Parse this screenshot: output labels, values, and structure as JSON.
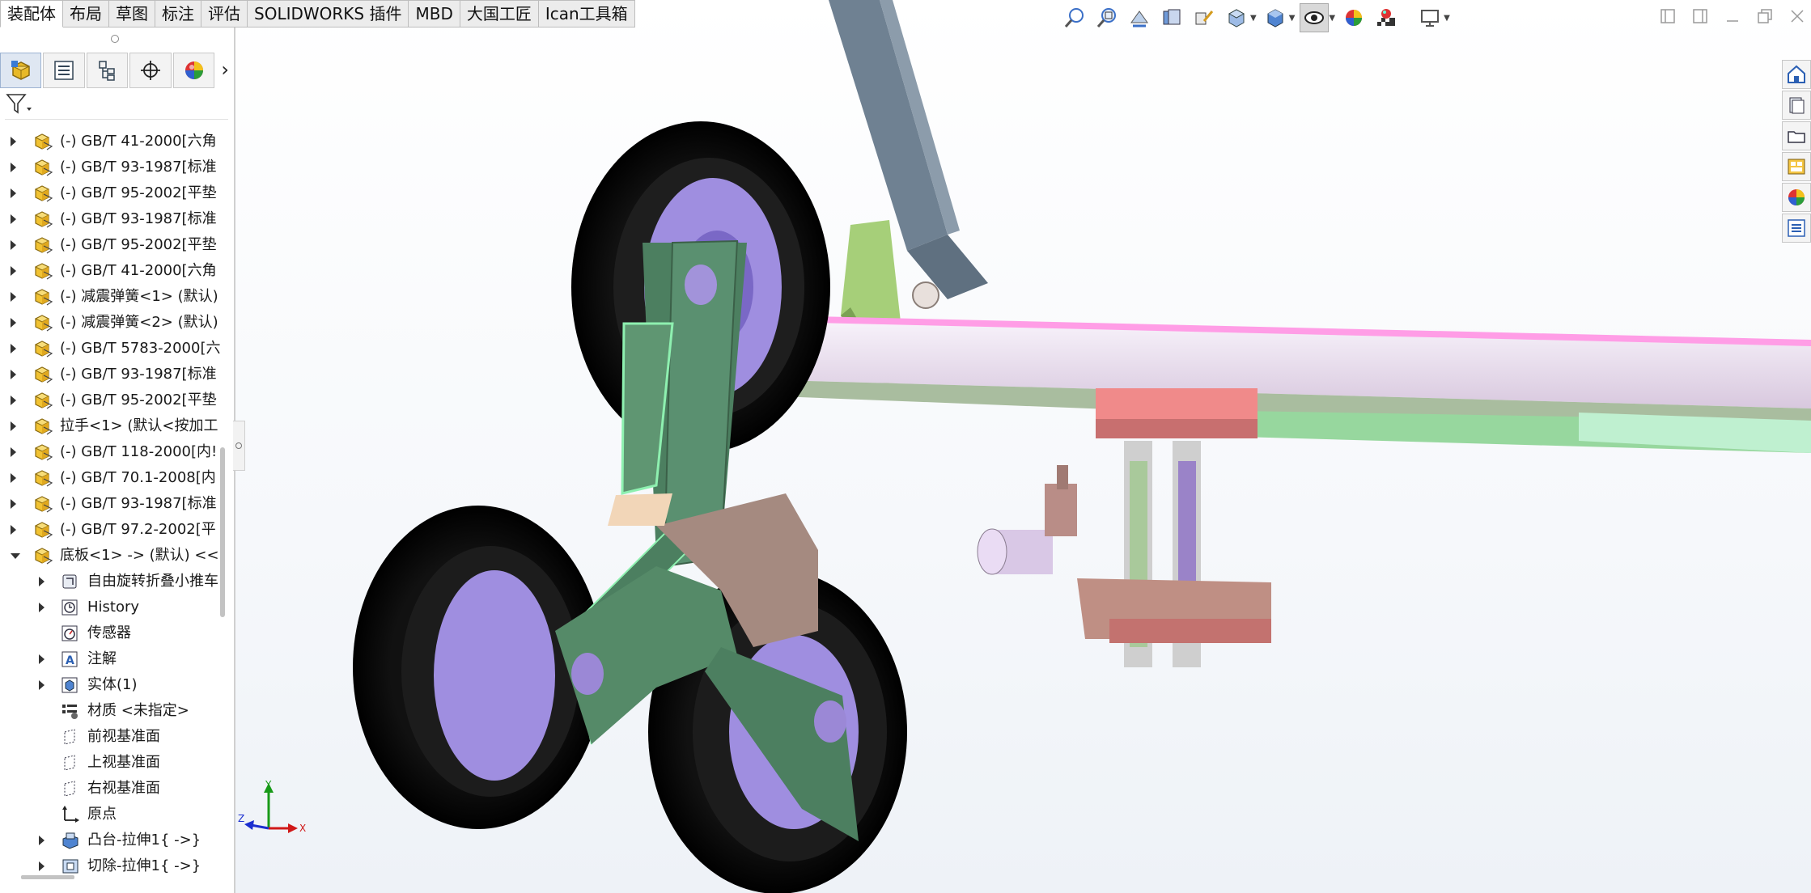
{
  "command_tabs": [
    "装配体",
    "布局",
    "草图",
    "标注",
    "评估",
    "SOLIDWORKS 插件",
    "MBD",
    "大国工匠",
    "Ican工具箱"
  ],
  "active_tab_index": 0,
  "manager_tabs": [
    "featuremanager-icon",
    "propertymanager-icon",
    "configurationmanager-icon",
    "dimxpert-icon",
    "display-manager-icon"
  ],
  "tree": {
    "items": [
      {
        "label": "(-) GB/T 41-2000[六角",
        "icon": "part-icon",
        "level": 0,
        "expanded": false
      },
      {
        "label": "(-) GB/T 93-1987[标准",
        "icon": "part-icon",
        "level": 0,
        "expanded": false
      },
      {
        "label": "(-) GB/T 95-2002[平垫",
        "icon": "part-icon",
        "level": 0,
        "expanded": false
      },
      {
        "label": "(-) GB/T 93-1987[标准",
        "icon": "part-icon",
        "level": 0,
        "expanded": false
      },
      {
        "label": "(-) GB/T 95-2002[平垫",
        "icon": "part-icon",
        "level": 0,
        "expanded": false
      },
      {
        "label": "(-) GB/T 41-2000[六角",
        "icon": "part-icon",
        "level": 0,
        "expanded": false
      },
      {
        "label": "(-) 减震弹簧<1> (默认)",
        "icon": "part-icon",
        "level": 0,
        "expanded": false
      },
      {
        "label": "(-) 减震弹簧<2> (默认)",
        "icon": "part-icon",
        "level": 0,
        "expanded": false
      },
      {
        "label": "(-) GB/T 5783-2000[六",
        "icon": "part-icon",
        "level": 0,
        "expanded": false
      },
      {
        "label": "(-) GB/T 93-1987[标准",
        "icon": "part-icon",
        "level": 0,
        "expanded": false
      },
      {
        "label": "(-) GB/T 95-2002[平垫",
        "icon": "part-icon",
        "level": 0,
        "expanded": false
      },
      {
        "label": "拉手<1> (默认<按加工",
        "icon": "part-icon",
        "level": 0,
        "expanded": false
      },
      {
        "label": "(-) GB/T 118-2000[内!",
        "icon": "part-icon",
        "level": 0,
        "expanded": false
      },
      {
        "label": "(-) GB/T 70.1-2008[内",
        "icon": "part-icon",
        "level": 0,
        "expanded": false
      },
      {
        "label": "(-) GB/T 93-1987[标准",
        "icon": "part-icon",
        "level": 0,
        "expanded": false
      },
      {
        "label": "(-) GB/T 97.2-2002[平",
        "icon": "part-icon",
        "level": 0,
        "expanded": false
      },
      {
        "label": "底板<1> -> (默认) <<!",
        "icon": "part-icon",
        "level": 0,
        "expanded": true
      },
      {
        "label": "自由旋转折叠小推车",
        "icon": "assembly-icon",
        "level": 1,
        "expanded": false
      },
      {
        "label": "History",
        "icon": "history-icon",
        "level": 1,
        "expanded": false
      },
      {
        "label": "传感器",
        "icon": "sensor-icon",
        "level": 1,
        "expanded": null
      },
      {
        "label": "注解",
        "icon": "annotation-icon",
        "level": 1,
        "expanded": false
      },
      {
        "label": "实体(1)",
        "icon": "solid-body-icon",
        "level": 1,
        "expanded": false
      },
      {
        "label": "材质 <未指定>",
        "icon": "material-icon",
        "level": 1,
        "expanded": null
      },
      {
        "label": "前视基准面",
        "icon": "plane-icon",
        "level": 1,
        "expanded": null
      },
      {
        "label": "上视基准面",
        "icon": "plane-icon",
        "level": 1,
        "expanded": null
      },
      {
        "label": "右视基准面",
        "icon": "plane-icon",
        "level": 1,
        "expanded": null
      },
      {
        "label": "原点",
        "icon": "origin-icon",
        "level": 1,
        "expanded": null
      },
      {
        "label": "凸台-拉伸1{ ->}",
        "icon": "boss-extrude-icon",
        "level": 1,
        "expanded": false
      },
      {
        "label": "切除-拉伸1{ ->}",
        "icon": "cut-extrude-icon",
        "level": 1,
        "expanded": false
      }
    ]
  },
  "heads_up_toolbar": [
    "zoom-to-fit-icon",
    "zoom-to-area-icon",
    "previous-view-icon",
    "section-view-icon",
    "dynamic-annotation-icon",
    "view-orientation-icon",
    "display-style-icon",
    "hide-show-items-icon",
    "edit-appearance-icon",
    "apply-scene-icon",
    "view-settings-icon"
  ],
  "task_pane": [
    "solidworks-resources-icon",
    "design-library-icon",
    "file-explorer-icon",
    "view-palette-icon",
    "appearances-icon",
    "custom-properties-icon"
  ],
  "triad": {
    "x": "X",
    "y": "Y",
    "z": "Z"
  },
  "colors": {
    "x_axis": "#d01818",
    "y_axis": "#189a18",
    "z_axis": "#1c2fd0",
    "accent": "#dfe7f2"
  }
}
